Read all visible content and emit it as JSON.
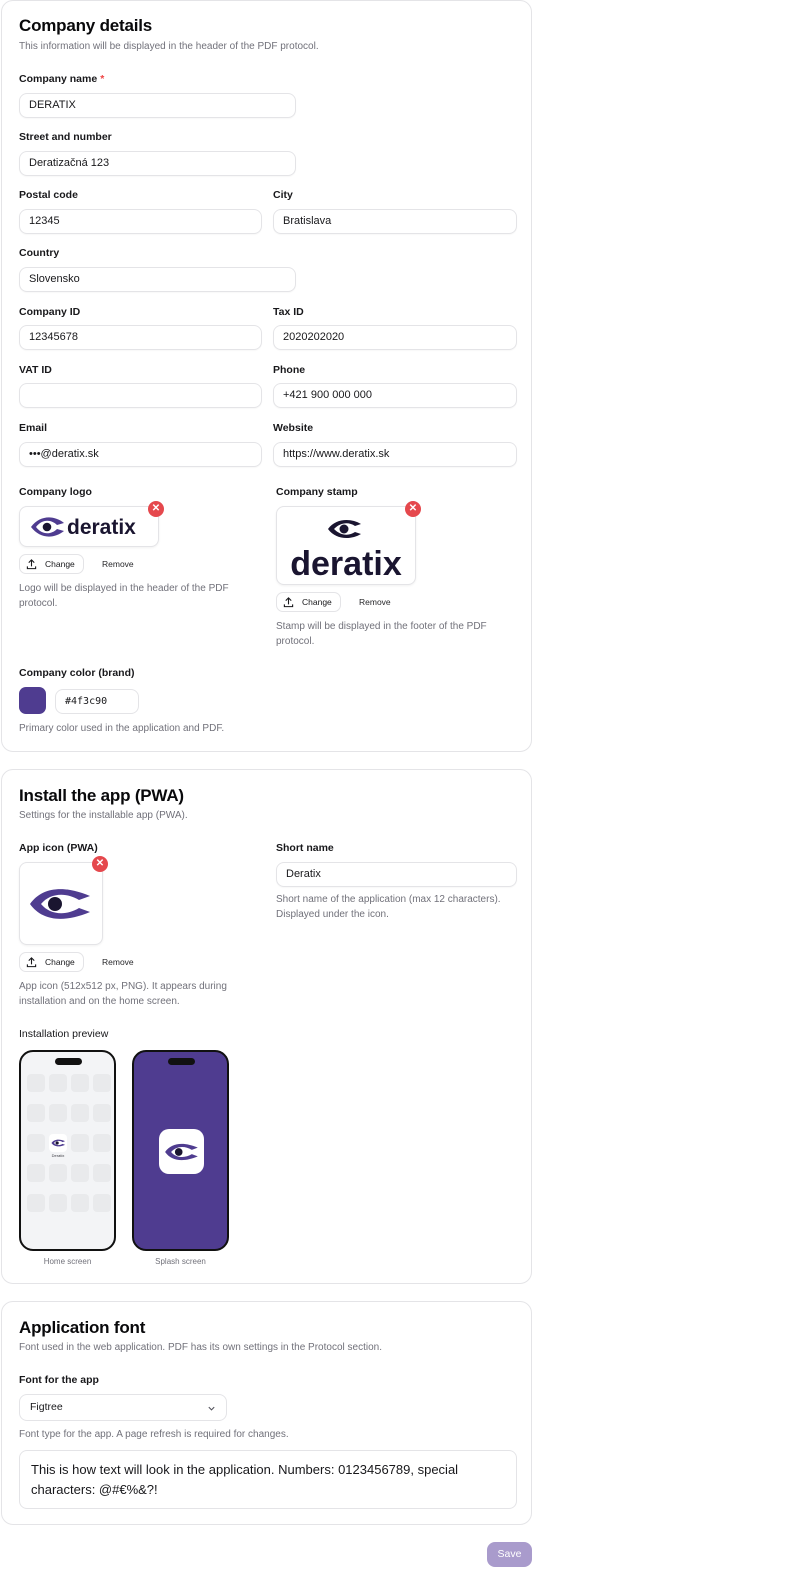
{
  "colors": {
    "brand": "#4f3c90",
    "danger": "#e5484d",
    "save_bg": "#a99bcc",
    "phone_home_bg": "#f3f4f6",
    "phone_splash_bg": "#4f3c90"
  },
  "company": {
    "title": "Company details",
    "subtitle": "This information will be displayed in the header of the PDF protocol.",
    "fields": {
      "name": {
        "label": "Company name",
        "required_mark": "*",
        "value": "DERATIX"
      },
      "street": {
        "label": "Street and number",
        "value": "Deratizačná 123"
      },
      "postal": {
        "label": "Postal code",
        "value": "12345"
      },
      "city": {
        "label": "City",
        "value": "Bratislava"
      },
      "country": {
        "label": "Country",
        "value": "Slovensko"
      },
      "company_id": {
        "label": "Company ID",
        "value": "12345678"
      },
      "tax_id": {
        "label": "Tax ID",
        "value": "2020202020"
      },
      "vat_id": {
        "label": "VAT ID",
        "value": ""
      },
      "phone": {
        "label": "Phone",
        "value": "+421 900 000 000"
      },
      "email": {
        "label": "Email",
        "value": "•••@deratix.sk"
      },
      "website": {
        "label": "Website",
        "value": "https://www.deratix.sk"
      }
    },
    "logo": {
      "label": "Company logo",
      "wordmark": "deratix",
      "change": "Change",
      "remove": "Remove",
      "help": "Logo will be displayed in the header of the PDF protocol.",
      "icon": "eye-logo-icon"
    },
    "stamp": {
      "label": "Company stamp",
      "wordmark": "deratix",
      "change": "Change",
      "remove": "Remove",
      "help": "Stamp will be displayed in the footer of the PDF protocol.",
      "icon": "eye-logo-icon"
    },
    "brand_color": {
      "label": "Company color (brand)",
      "value": "#4f3c90",
      "help": "Primary color used in the application and PDF."
    }
  },
  "pwa": {
    "title": "Install the app (PWA)",
    "subtitle": "Settings for the installable app (PWA).",
    "icon": {
      "label": "App icon (PWA)",
      "change": "Change",
      "remove": "Remove",
      "help": "App icon (512x512 px, PNG). It appears during installation and on the home screen."
    },
    "short_name": {
      "label": "Short name",
      "value": "Deratix",
      "help": "Short name of the application (max 12 characters). Displayed under the icon."
    },
    "preview": {
      "label": "Installation preview",
      "home_caption": "Home screen",
      "splash_caption": "Splash screen",
      "home_app_label": "Deratix"
    }
  },
  "font": {
    "title": "Application font",
    "subtitle": "Font used in the web application. PDF has its own settings in the Protocol section.",
    "label": "Font for the app",
    "selected": "Figtree",
    "help": "Font type for the app. A page refresh is required for changes.",
    "preview_text": "This is how text will look in the application. Numbers: 0123456789, special characters: @#€%&?!"
  },
  "save_label": "Save"
}
